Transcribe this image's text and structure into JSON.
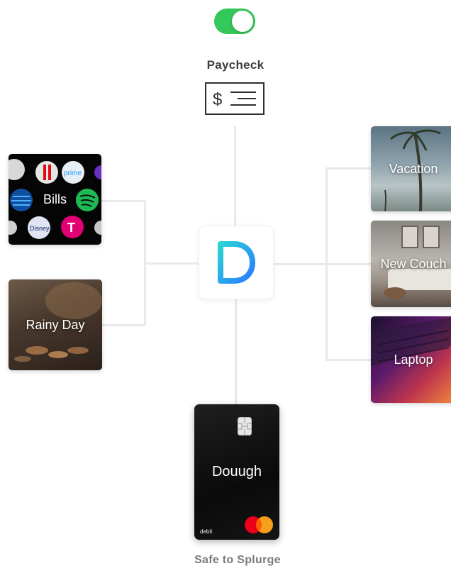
{
  "toggle": {
    "state": "on",
    "color": "#34c759"
  },
  "paycheck": {
    "label": "Paycheck",
    "icon": "check-dollar-icon"
  },
  "center": {
    "logo": "douugh-logo",
    "colors": [
      "#2ad4d4",
      "#2a7bff"
    ]
  },
  "left_tiles": [
    {
      "label": "Bills"
    },
    {
      "label": "Rainy Day"
    }
  ],
  "right_tiles": [
    {
      "label": "Vacation"
    },
    {
      "label": "New Couch"
    },
    {
      "label": "Laptop"
    }
  ],
  "card": {
    "brand": "Douugh",
    "type": "debit",
    "network": "mastercard-icon"
  },
  "bottom_label": "Safe to Splurge"
}
